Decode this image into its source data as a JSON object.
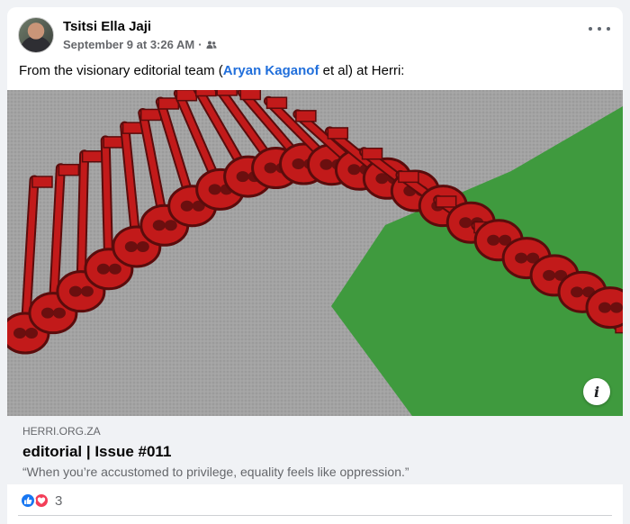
{
  "post": {
    "author": "Tsitsi Ella Jaji",
    "timestamp": "September 9 at 3:26 AM",
    "separator": "·",
    "audience_icon": "friends-icon",
    "text_before": "From the visionary editorial team (",
    "mention": "Aryan Kaganof",
    "text_after": " et al) at Herri:"
  },
  "link_preview": {
    "domain": "HERRI.ORG.ZA",
    "title": "editorial | Issue #011",
    "description": "“When you’re accustomed to privilege, equality feels like oppression.”",
    "image_icon": "info-icon",
    "info_glyph": "i"
  },
  "reactions": {
    "types": [
      "like-icon",
      "love-icon"
    ],
    "count": "3"
  },
  "colors": {
    "link": "#216fdb",
    "key_red": "#c21a1a",
    "green": "#3f9a3e",
    "background_gray": "#9c9c9c"
  }
}
